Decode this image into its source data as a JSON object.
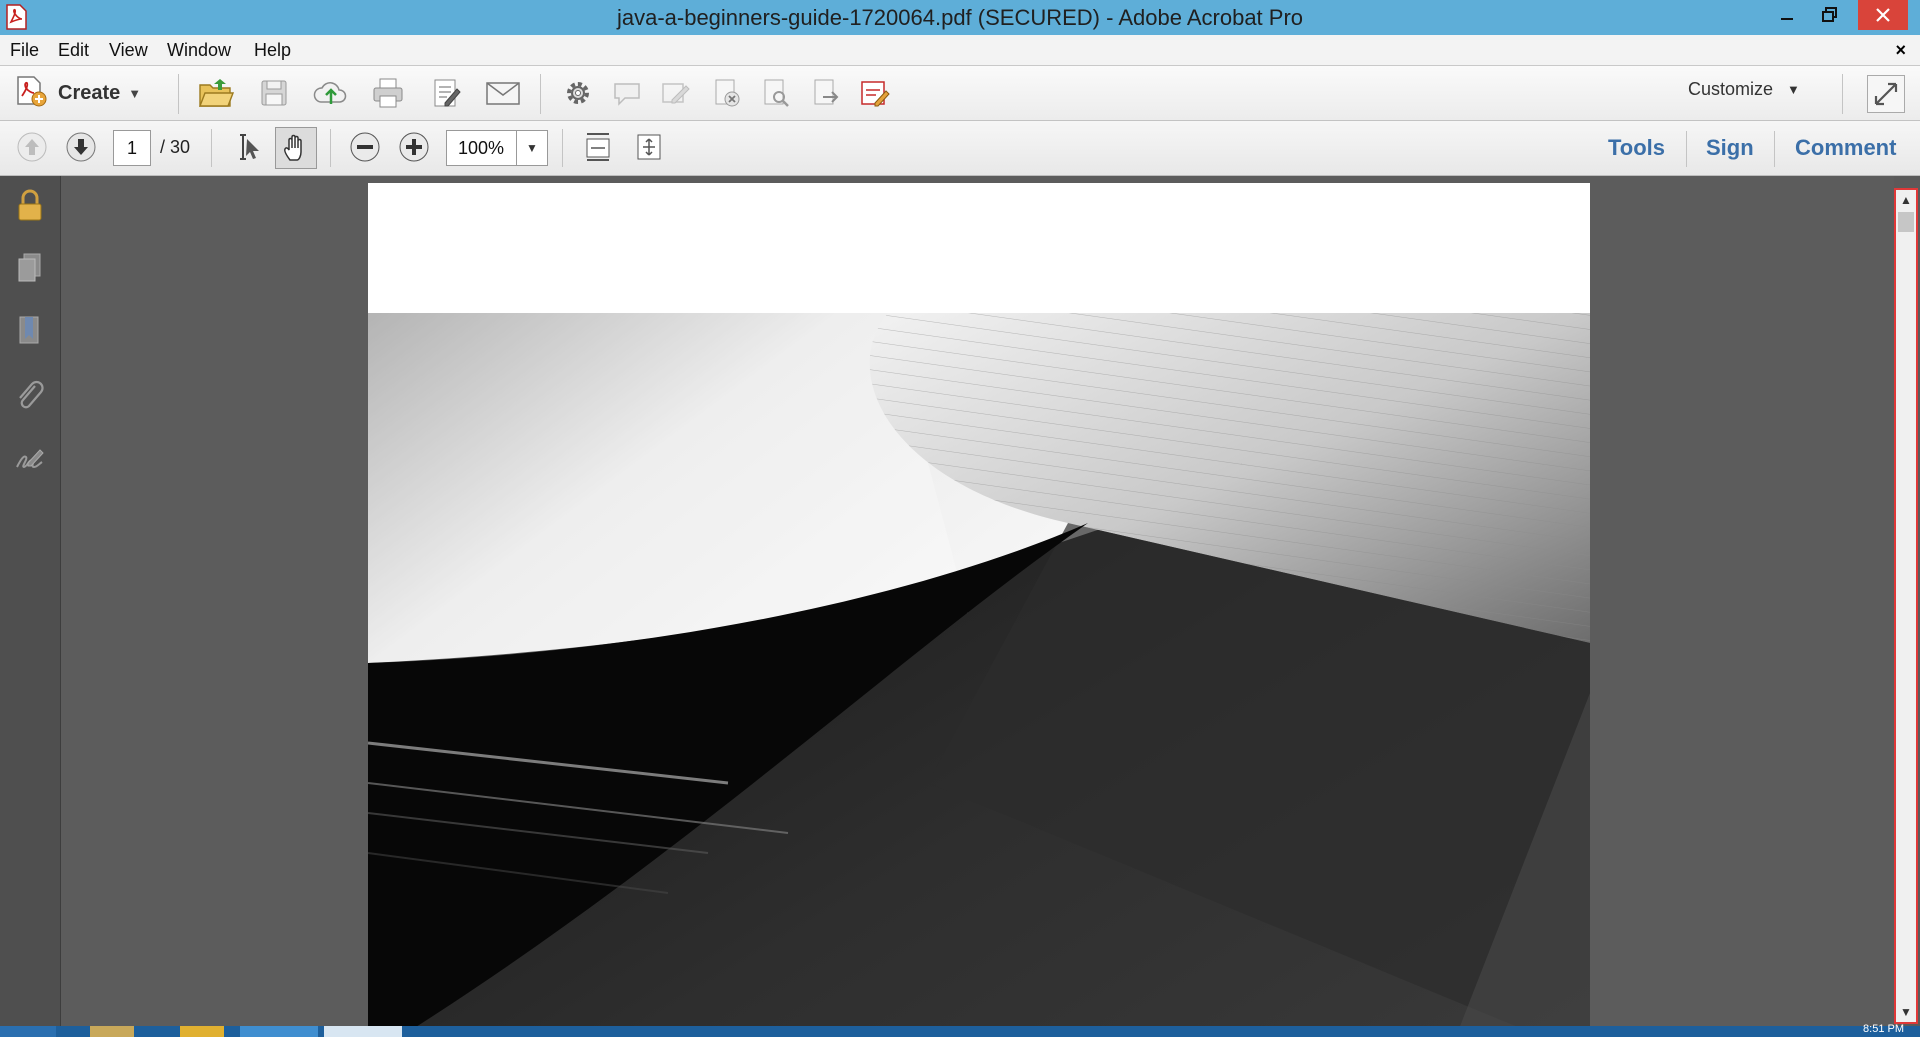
{
  "window": {
    "title": "java-a-beginners-guide-1720064.pdf (SECURED) - Adobe Acrobat Pro"
  },
  "menu": {
    "items": [
      "File",
      "Edit",
      "View",
      "Window",
      "Help"
    ],
    "close_doc": "×"
  },
  "toolbar": {
    "create_label": "Create",
    "customize_label": "Customize"
  },
  "navigation": {
    "current_page": "1",
    "total_pages": "/ 30",
    "zoom": "100%"
  },
  "panes": {
    "tools": "Tools",
    "sign": "Sign",
    "comment": "Comment"
  },
  "taskbar": {
    "clock": "8:51 PM"
  },
  "colors": {
    "titlebar": "#5eaed8",
    "close_button": "#d9443a",
    "pane_links": "#3b6fa8",
    "scrollbar_highlight": "#e03838"
  }
}
